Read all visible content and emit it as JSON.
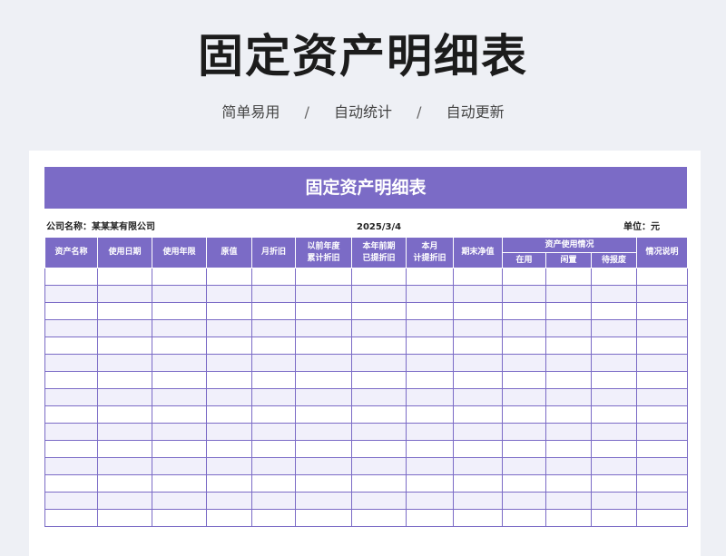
{
  "hero": {
    "title": "固定资产明细表",
    "taglines": [
      "简单易用",
      "自动统计",
      "自动更新"
    ],
    "separator": "/"
  },
  "sheet": {
    "banner_title": "固定资产明细表",
    "company_label": "公司名称：某某某有限公司",
    "date": "2025/3/4",
    "unit_label": "单位：元",
    "columns": {
      "asset_name": "资产名称",
      "use_date": "使用日期",
      "use_years": "使用年限",
      "original_value": "原值",
      "monthly_depreciation": "月折旧",
      "prior_year_acc_line1": "以前年度",
      "prior_year_acc_line2": "累计折旧",
      "year_previous_line1": "本年前期",
      "year_previous_line2": "已提折旧",
      "this_month_line1": "本月",
      "this_month_line2": "计提折旧",
      "ending_net_value": "期末净值",
      "usage_status_group": "资产使用情况",
      "in_use": "在用",
      "idle": "闲置",
      "pending_scrap": "待报废",
      "notes": "情况说明"
    }
  },
  "colors": {
    "accent": "#7b6bc6",
    "row_alt": "#f1f0fb",
    "page_bg": "#eef0f5"
  }
}
